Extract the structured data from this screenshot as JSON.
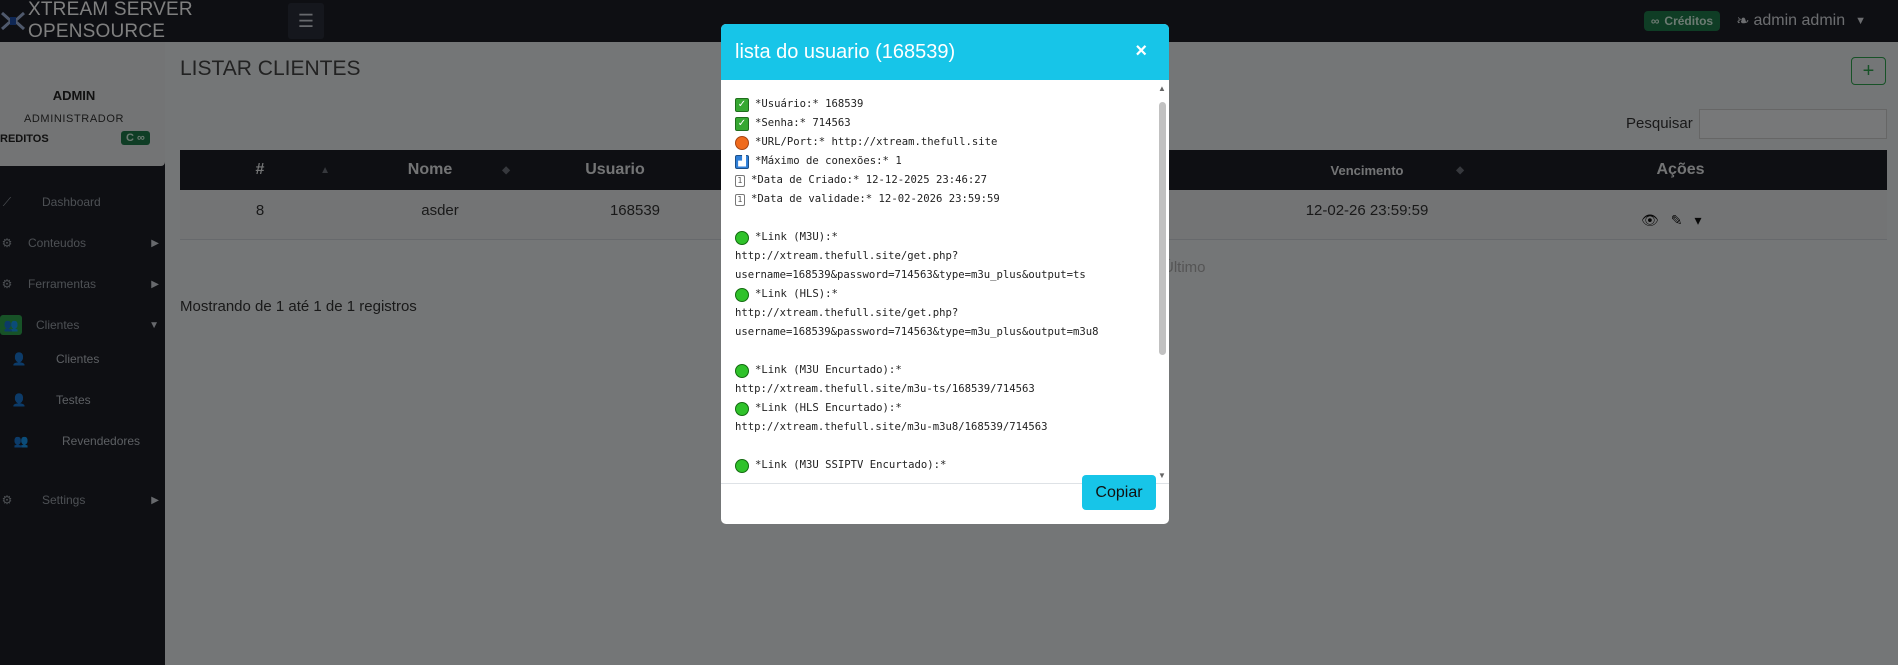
{
  "brand": {
    "name": "XTREAM SERVER OPENSOURCE",
    "menu_icon": "hamburger-icon"
  },
  "topbar": {
    "credits_label": "Créditos",
    "user_name": "admin admin"
  },
  "sidebar": {
    "profile_name": "ADMIN",
    "profile_role": "ADMINISTRADOR",
    "credits_label": "REDITOS",
    "credits_value": "C ∞",
    "items": [
      {
        "label": "Dashboard"
      },
      {
        "label": "Conteudos"
      },
      {
        "label": "Ferramentas"
      },
      {
        "label": "Clientes"
      }
    ],
    "sub_items": [
      {
        "label": "Clientes"
      },
      {
        "label": "Testes"
      },
      {
        "label": "Revendedores"
      }
    ],
    "settings_label": "Settings"
  },
  "page": {
    "title": "LISTAR CLIENTES",
    "add_label": "+",
    "search_label": "Pesquisar",
    "search_value": "",
    "info": "Mostrando de 1 até 1 de 1 registros",
    "pager_last": "Último"
  },
  "table": {
    "headers": [
      "#",
      "Nome",
      "Usuario",
      "Vencimento",
      "Ações"
    ],
    "row": {
      "id": "8",
      "name": "asder",
      "user": "168539",
      "expiry": "12-02-26 23:59:59"
    }
  },
  "modal": {
    "title": "lista do usuario (168539)",
    "close": "×",
    "copy_label": "Copiar",
    "lines": {
      "usuario": "*Usuário:* 168539",
      "senha": "*Senha:* 714563",
      "url": "*URL/Port:* http://xtream.thefull.site",
      "max": "*Máximo de conexões:* 1",
      "criado": "*Data de Criado:* 12-12-2025 23:46:27",
      "validade": "*Data de validade:* 12-02-2026 23:59:59",
      "m3u_label": "*Link (M3U):*",
      "m3u_url1": "http://xtream.thefull.site/get.php?",
      "m3u_url2": "username=168539&password=714563&type=m3u_plus&output=ts",
      "hls_label": "*Link (HLS):*",
      "hls_url1": "http://xtream.thefull.site/get.php?",
      "hls_url2": "username=168539&password=714563&type=m3u_plus&output=m3u8",
      "m3u_short_label": "*Link (M3U Encurtado):*",
      "m3u_short_url": "http://xtream.thefull.site/m3u-ts/168539/714563",
      "hls_short_label": "*Link (HLS Encurtado):*",
      "hls_short_url": "http://xtream.thefull.site/m3u-m3u8/168539/714563",
      "partial": "*Link (M3U SSIPTV Encurtado):*"
    }
  }
}
